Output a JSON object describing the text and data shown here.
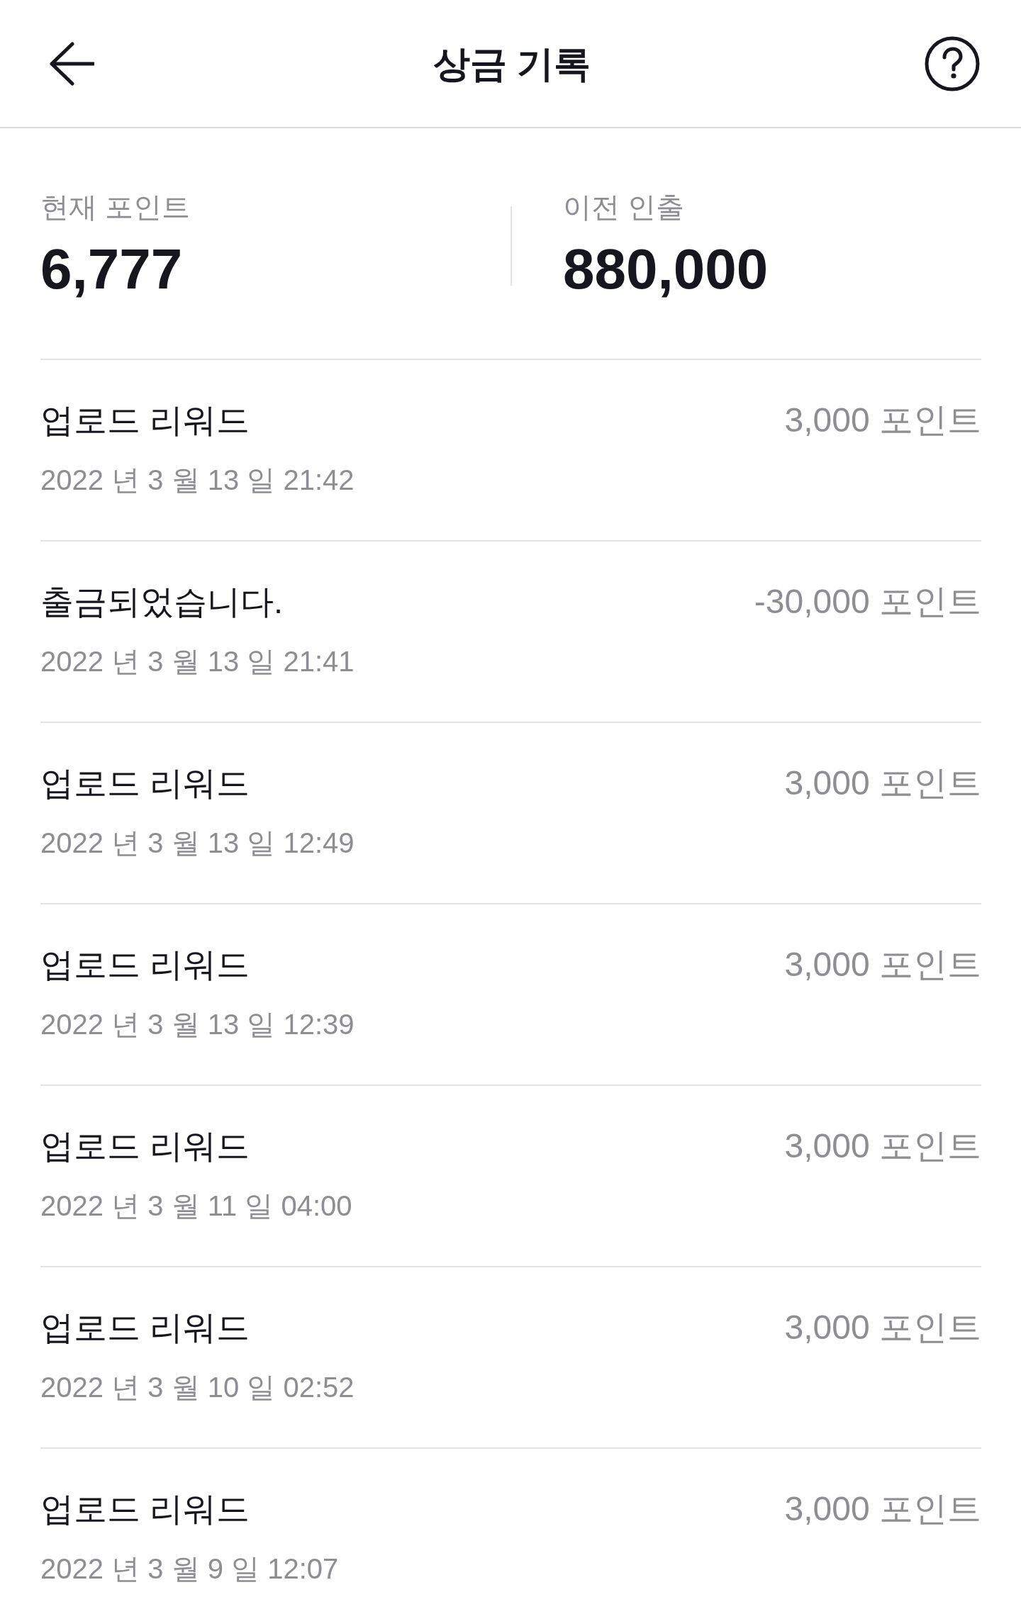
{
  "header": {
    "title": "상금 기록"
  },
  "summary": [
    {
      "label": "현재 포인트",
      "value": "6,777"
    },
    {
      "label": "이전 인출",
      "value": "880,000"
    }
  ],
  "records": [
    {
      "title": "업로드 리워드",
      "date": "2022 년 3 월 13 일 21:42",
      "amount": "3,000 포인트"
    },
    {
      "title": "출금되었습니다.",
      "date": "2022 년 3 월 13 일 21:41",
      "amount": "-30,000 포인트"
    },
    {
      "title": "업로드 리워드",
      "date": "2022 년 3 월 13 일 12:49",
      "amount": "3,000 포인트"
    },
    {
      "title": "업로드 리워드",
      "date": "2022 년 3 월 13 일 12:39",
      "amount": "3,000 포인트"
    },
    {
      "title": "업로드 리워드",
      "date": "2022 년 3 월 11 일 04:00",
      "amount": "3,000 포인트"
    },
    {
      "title": "업로드 리워드",
      "date": "2022 년 3 월 10 일 02:52",
      "amount": "3,000 포인트"
    },
    {
      "title": "업로드 리워드",
      "date": "2022 년 3 월 9 일 12:07",
      "amount": "3,000 포인트"
    }
  ]
}
